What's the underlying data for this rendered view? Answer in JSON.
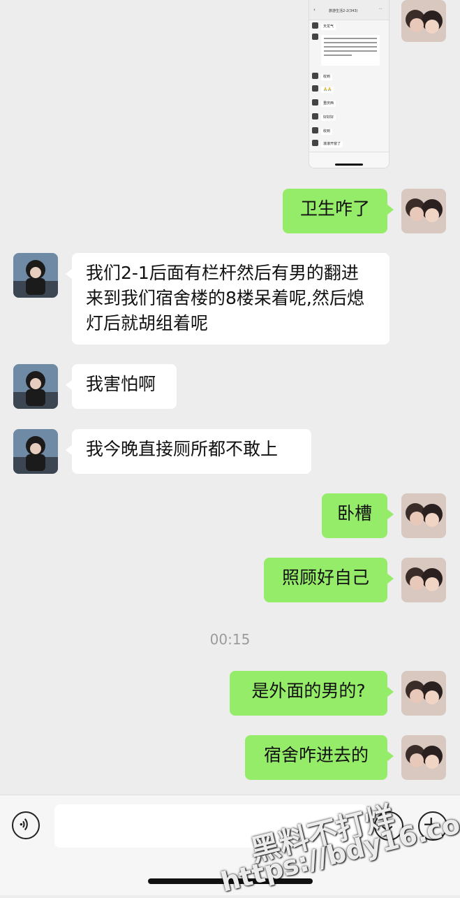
{
  "embedded_screenshot": {
    "group_title": "旅游生活2-2(343)",
    "messages": [
      "天龙气",
      "收到",
      "🙏🙏",
      "重庆西",
      "好好好",
      "收到",
      "滚滚开窗了"
    ]
  },
  "messages": [
    {
      "side": "in",
      "text": "我们2-1后面有栏杆然后有男的翻进来到我们宿舍楼的8楼呆着呢,然后熄灯后就胡组着呢"
    },
    {
      "side": "in",
      "text": "我害怕啊"
    },
    {
      "side": "in",
      "text": "我今晚直接厕所都不敢上"
    },
    {
      "side": "out",
      "text": "卫生咋了"
    },
    {
      "side": "out",
      "text": "卧槽"
    },
    {
      "side": "out",
      "text": "照顾好自己"
    },
    {
      "side": "out",
      "text": "是外面的男的?"
    },
    {
      "side": "out",
      "text": "宿舍咋进去的"
    }
  ],
  "timestamp": "00:15",
  "input": {
    "placeholder": "",
    "value": ""
  },
  "icons": {
    "voice": "voice-icon",
    "emoji": "emoji-icon",
    "plus": "plus-icon"
  },
  "watermark": {
    "line1": "黑料不打烊",
    "line2": "https://bdy16.co"
  },
  "colors": {
    "background": "#ededed",
    "outgoing_bubble": "#95ec69",
    "incoming_bubble": "#ffffff"
  }
}
